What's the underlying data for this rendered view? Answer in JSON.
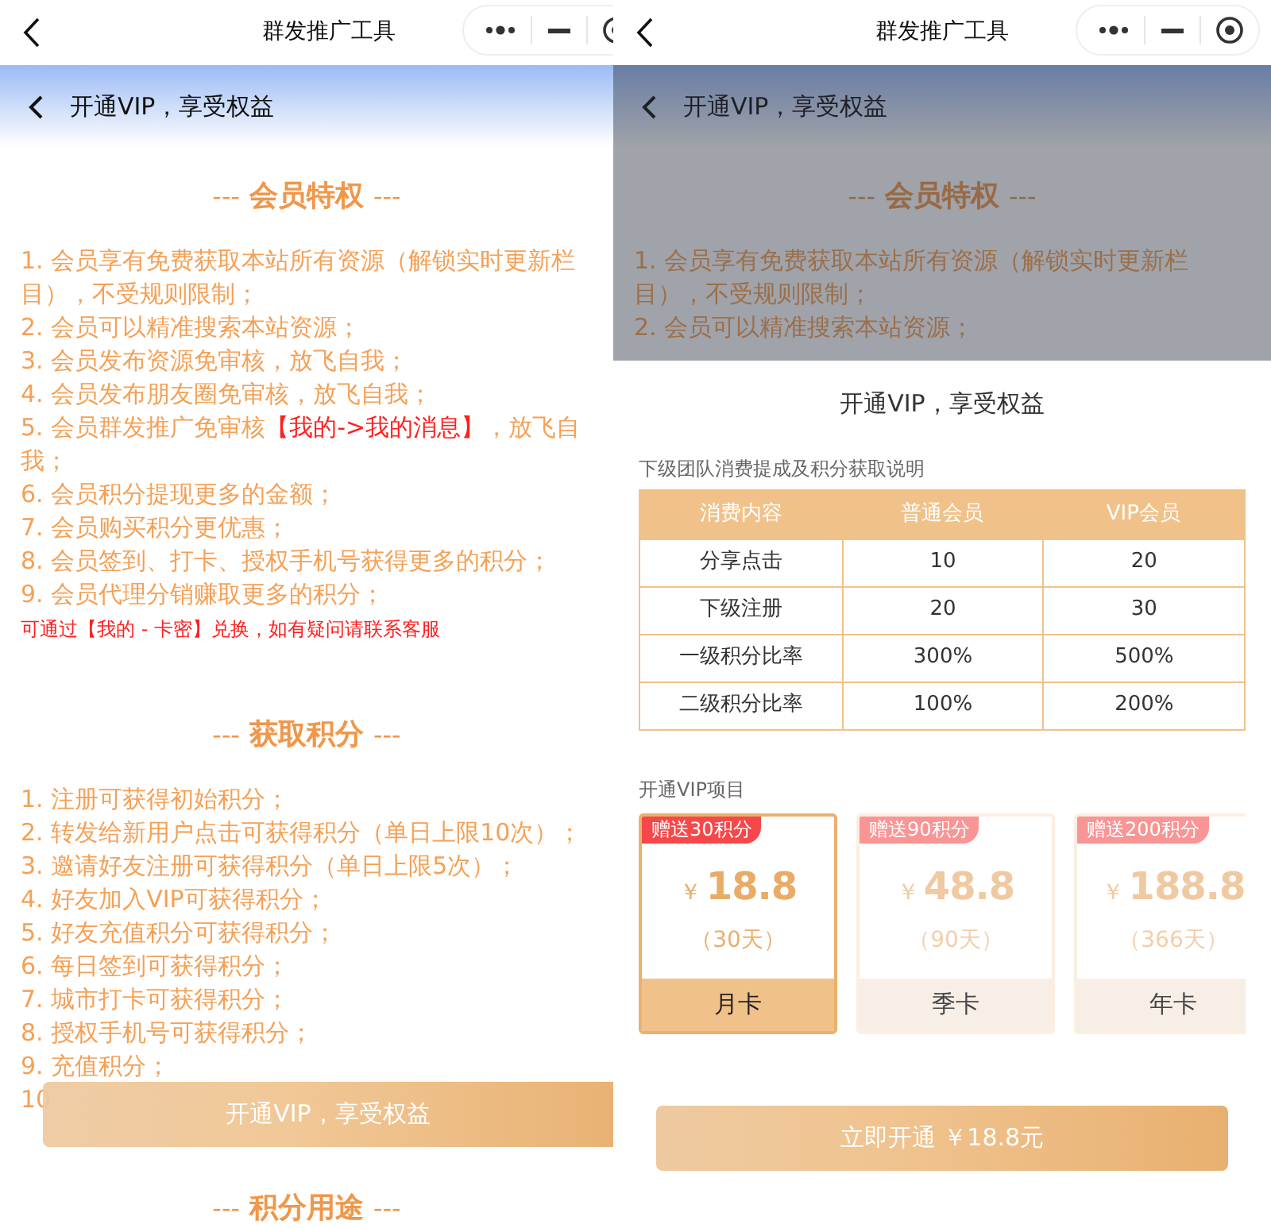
{
  "screens": [
    {
      "nav": {
        "title": "群发推广工具"
      },
      "page_title": "开通VIP，享受权益",
      "sections": [
        {
          "mark_left": "---",
          "title": "会员特权",
          "mark_right": "---",
          "items": [
            {
              "text": "1. 会员享有免费获取本站所有资源（解锁实时更新栏目），不受规则限制；"
            },
            {
              "text": "2. 会员可以精准搜索本站资源；"
            },
            {
              "text": "3. 会员发布资源免审核，放飞自我；"
            },
            {
              "text": "4. 会员发布朋友圈免审核，放飞自我；"
            },
            {
              "parts": [
                {
                  "text": "5. 会员群发推广免审核",
                  "highlight": false
                },
                {
                  "text": "【我的->我的消息】",
                  "highlight": true
                },
                {
                  "text": "，放飞自我；",
                  "highlight": false
                }
              ]
            },
            {
              "text": "6. 会员积分提现更多的金额；"
            },
            {
              "text": "7. 会员购买积分更优惠；"
            },
            {
              "text": "8. 会员签到、打卡、授权手机号获得更多的积分；"
            },
            {
              "text": "9. 会员代理分销赚取更多的积分；"
            }
          ],
          "note": "可通过【我的 - 卡密】兑换，如有疑问请联系客服"
        },
        {
          "mark_left": "---",
          "title": "获取积分",
          "mark_right": "---",
          "items": [
            {
              "text": "1. 注册可获得初始积分；"
            },
            {
              "text": "2. 转发给新用户点击可获得积分（单日上限10次）；"
            },
            {
              "text": "3. 邀请好友注册可获得积分（单日上限5次）；"
            },
            {
              "text": "4. 好友加入VIP可获得积分；"
            },
            {
              "text": "5. 好友充值积分可获得积分；"
            },
            {
              "text": "6. 每日签到可获得积分；"
            },
            {
              "text": "7. 城市打卡可获得积分；"
            },
            {
              "text": "8. 授权手机号可获得积分；"
            },
            {
              "text": "9. 充值积分；"
            },
            {
              "text": "10"
            }
          ]
        },
        {
          "mark_left": "---",
          "title": "积分用途",
          "mark_right": "---"
        }
      ],
      "float_button": "开通VIP，享受权益"
    },
    {
      "nav": {
        "title": "群发推广工具"
      },
      "page_title": "开通VIP，享受权益",
      "sections": [
        {
          "mark_left": "---",
          "title": "会员特权",
          "mark_right": "---",
          "items": [
            {
              "text": "1. 会员享有免费获取本站所有资源（解锁实时更新栏目），不受规则限制；"
            },
            {
              "text": "2. 会员可以精准搜索本站资源；"
            }
          ]
        }
      ],
      "sheet": {
        "title": "开通VIP，享受权益",
        "table_caption": "下级团队消费提成及积分获取说明",
        "table": {
          "columns": [
            "消费内容",
            "普通会员",
            "VIP会员"
          ],
          "rows": [
            [
              "分享点击",
              "10",
              "20"
            ],
            [
              "下级注册",
              "20",
              "30"
            ],
            [
              "一级积分比率",
              "300%",
              "500%"
            ],
            [
              "二级积分比率",
              "100%",
              "200%"
            ]
          ]
        },
        "plans_caption": "开通VIP项目",
        "plans": [
          {
            "badge": "赠送30积分",
            "currency": "￥",
            "price": "18.8",
            "duration": "（30天）",
            "label": "月卡",
            "selected": true
          },
          {
            "badge": "赠送90积分",
            "currency": "￥",
            "price": "48.8",
            "duration": "（90天）",
            "label": "季卡",
            "selected": false
          },
          {
            "badge": "赠送200积分",
            "currency": "￥",
            "price": "188.8",
            "duration": "（366天）",
            "label": "年卡",
            "selected": false
          }
        ],
        "button": "立即开通 ￥18.8元"
      }
    }
  ]
}
